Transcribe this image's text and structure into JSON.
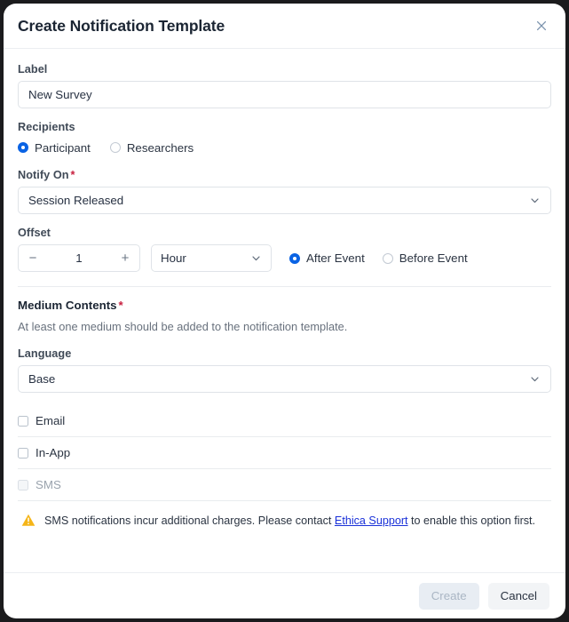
{
  "dialog": {
    "title": "Create Notification Template",
    "close_icon": "close-icon"
  },
  "label_field": {
    "label": "Label",
    "value": "New Survey",
    "placeholder": "Label"
  },
  "recipients": {
    "label": "Recipients",
    "options": [
      {
        "label": "Participant",
        "selected": true
      },
      {
        "label": "Researchers",
        "selected": false
      }
    ]
  },
  "notify_on": {
    "label": "Notify On",
    "required_marker": "*",
    "value": "Session Released"
  },
  "offset": {
    "label": "Offset",
    "decrement_label": "−",
    "value": "1",
    "increment_label": "+",
    "unit": "Hour",
    "direction_options": [
      {
        "label": "After Event",
        "selected": true
      },
      {
        "label": "Before Event",
        "selected": false
      }
    ]
  },
  "medium_contents": {
    "title": "Medium Contents",
    "required_marker": "*",
    "note": "At least one medium should be added to the notification template."
  },
  "language": {
    "label": "Language",
    "value": "Base"
  },
  "mediums": [
    {
      "label": "Email",
      "checked": false,
      "disabled": false
    },
    {
      "label": "In-App",
      "checked": false,
      "disabled": false
    },
    {
      "label": "SMS",
      "checked": false,
      "disabled": true
    }
  ],
  "warning": {
    "icon": "warning-triangle-icon",
    "text_before": "SMS notifications incur additional charges. Please contact ",
    "link_text": "Ethica Support",
    "text_after": " to enable this option first."
  },
  "footer": {
    "create_label": "Create",
    "create_disabled": true,
    "cancel_label": "Cancel"
  },
  "colors": {
    "accent": "#0a63e4",
    "required": "#c8203f",
    "link": "#1a31d8",
    "warning": "#f5b518",
    "border": "#dfe3e8"
  }
}
